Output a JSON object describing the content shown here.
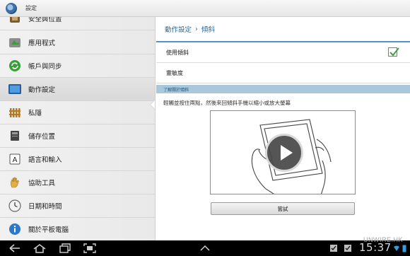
{
  "app": {
    "title": "設定"
  },
  "sidebar": {
    "items": [
      {
        "label": "安全與位置",
        "icon": "security-location-icon"
      },
      {
        "label": "應用程式",
        "icon": "applications-icon"
      },
      {
        "label": "帳戶與同步",
        "icon": "sync-icon"
      },
      {
        "label": "動作設定",
        "icon": "motion-icon",
        "selected": true
      },
      {
        "label": "私隱",
        "icon": "privacy-fence-icon"
      },
      {
        "label": "儲存位置",
        "icon": "storage-icon"
      },
      {
        "label": "語言和輸入",
        "icon": "language-input-icon"
      },
      {
        "label": "協助工具",
        "icon": "accessibility-hand-icon"
      },
      {
        "label": "日期和時間",
        "icon": "clock-icon"
      },
      {
        "label": "關於平板電腦",
        "icon": "info-icon"
      }
    ]
  },
  "content": {
    "breadcrumb": {
      "parent": "動作設定",
      "separator": "›",
      "current": "傾斜"
    },
    "use_tilt": {
      "label": "使用傾斜",
      "checked": true
    },
    "sensitivity": {
      "label": "靈敏度"
    },
    "section_header": "了解關於傾斜",
    "instruction": "輕觸並按住兩點，然後來回傾斜手機以縮小或放大螢幕",
    "try_button": "嘗試"
  },
  "system_bar": {
    "clock": "15:37"
  },
  "watermark": "UNWIRE.HK",
  "colors": {
    "accent": "#2a6b9c",
    "section_header_bg": "#a9c8dc",
    "check_green": "#3aa635"
  }
}
